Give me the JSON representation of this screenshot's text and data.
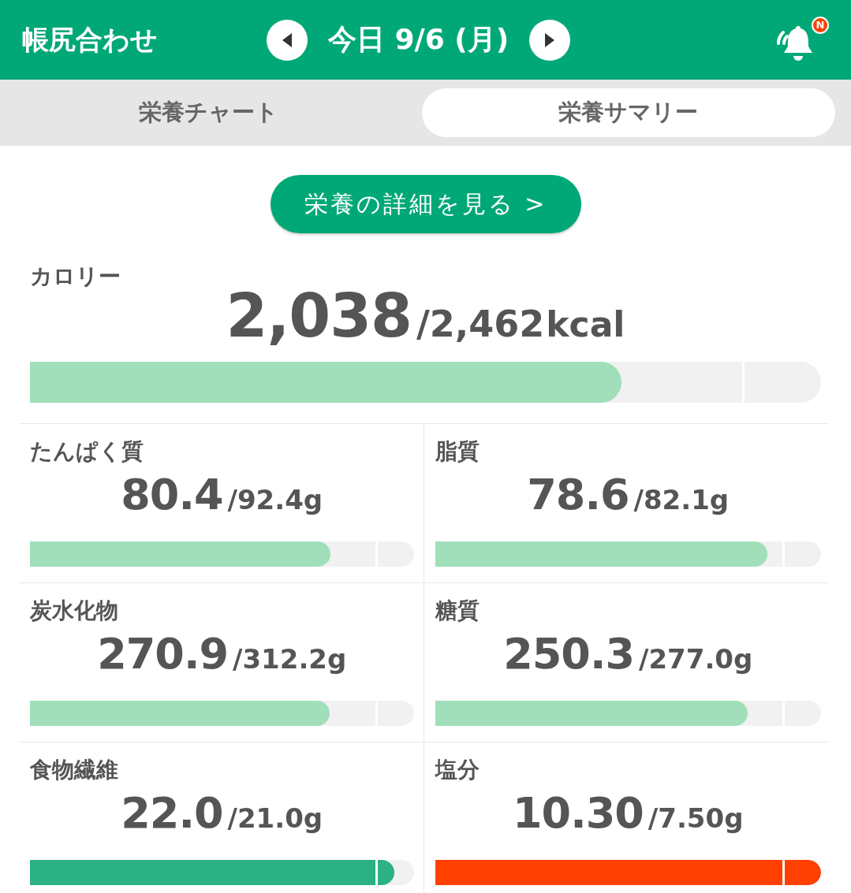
{
  "header": {
    "title": "帳尻合わせ",
    "date": "今日 9/6 (月)",
    "notification_badge": "N"
  },
  "tabs": [
    {
      "label": "栄養チャート",
      "selected": false
    },
    {
      "label": "栄養サマリー",
      "selected": true
    }
  ],
  "detail_button": "栄養の詳細を見る >",
  "calorie": {
    "label": "カロリー",
    "value": "2,038",
    "target": "/2,462",
    "unit": "kcal",
    "level": 0.748,
    "color": "#a0dfb9"
  },
  "nutrients": [
    {
      "label": "たんぱく質",
      "value": "80.4",
      "target": "/92.4g",
      "level": 0.783,
      "color": "#a0dfb9"
    },
    {
      "label": "脂質",
      "value": "78.6",
      "target": "/82.1g",
      "level": 0.862,
      "color": "#a0dfb9"
    },
    {
      "label": "炭水化物",
      "value": "270.9",
      "target": "/312.2g",
      "level": 0.781,
      "color": "#a0dfb9"
    },
    {
      "label": "糖質",
      "value": "250.3",
      "target": "/277.0g",
      "level": 0.81,
      "color": "#a0dfb9"
    },
    {
      "label": "食物繊維",
      "value": "22.0",
      "target": "/21.0g",
      "level": 0.95,
      "color": "#2bb184"
    },
    {
      "label": "塩分",
      "value": "10.30",
      "target": "/7.50g",
      "level": 1,
      "color": "#ff4000"
    }
  ]
}
